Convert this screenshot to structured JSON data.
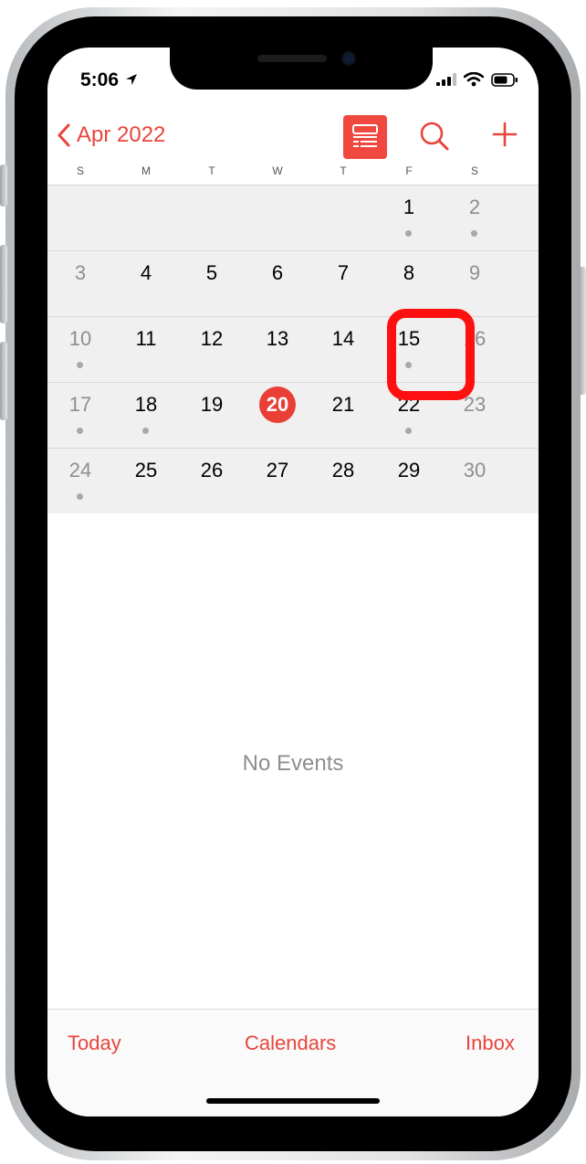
{
  "status": {
    "time": "5:06"
  },
  "nav": {
    "back_label": "Apr 2022",
    "icons": [
      "chevron-left-icon",
      "list-view-icon",
      "search-icon",
      "plus-icon"
    ]
  },
  "weekdays": [
    "S",
    "M",
    "T",
    "W",
    "T",
    "F",
    "S"
  ],
  "weeks": [
    [
      {
        "day": "",
        "dot": false
      },
      {
        "day": "",
        "dot": false
      },
      {
        "day": "",
        "dot": false
      },
      {
        "day": "",
        "dot": false
      },
      {
        "day": "",
        "dot": false
      },
      {
        "day": "1",
        "dot": true
      },
      {
        "day": "2",
        "dot": true
      }
    ],
    [
      {
        "day": "3",
        "dot": false
      },
      {
        "day": "4",
        "dot": false
      },
      {
        "day": "5",
        "dot": false
      },
      {
        "day": "6",
        "dot": false
      },
      {
        "day": "7",
        "dot": false
      },
      {
        "day": "8",
        "dot": false
      },
      {
        "day": "9",
        "dot": false
      }
    ],
    [
      {
        "day": "10",
        "dot": true
      },
      {
        "day": "11",
        "dot": false
      },
      {
        "day": "12",
        "dot": false
      },
      {
        "day": "13",
        "dot": false
      },
      {
        "day": "14",
        "dot": false
      },
      {
        "day": "15",
        "dot": true
      },
      {
        "day": "16",
        "dot": false
      }
    ],
    [
      {
        "day": "17",
        "dot": true
      },
      {
        "day": "18",
        "dot": true
      },
      {
        "day": "19",
        "dot": false
      },
      {
        "day": "20",
        "dot": false,
        "today": true
      },
      {
        "day": "21",
        "dot": false
      },
      {
        "day": "22",
        "dot": true
      },
      {
        "day": "23",
        "dot": false
      }
    ],
    [
      {
        "day": "24",
        "dot": true
      },
      {
        "day": "25",
        "dot": false
      },
      {
        "day": "26",
        "dot": false
      },
      {
        "day": "27",
        "dot": false
      },
      {
        "day": "28",
        "dot": false
      },
      {
        "day": "29",
        "dot": false
      },
      {
        "day": "30",
        "dot": false
      }
    ]
  ],
  "empty_message": "No Events",
  "tabbar": {
    "today": "Today",
    "calendars": "Calendars",
    "inbox": "Inbox"
  },
  "colors": {
    "accent": "#e8453c",
    "today_circle": "#ea3f36",
    "highlight": "#ff1010"
  }
}
